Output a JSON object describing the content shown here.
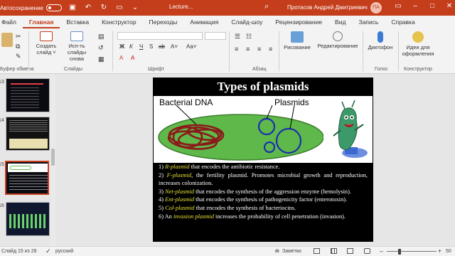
{
  "titlebar": {
    "autosave": "Автосохранение",
    "doc": "Lecture...",
    "user": "Протасов Андрей Дмитриевич",
    "avatar": "ПА"
  },
  "tabs": [
    "Файл",
    "Главная",
    "Вставка",
    "Конструктор",
    "Переходы",
    "Анимация",
    "Слайд-шоу",
    "Рецензирование",
    "Вид",
    "Запись",
    "Справка"
  ],
  "ribbon": {
    "create_slide": "Создать слайд ˅",
    "reuse": "Исп-ть слайды снова",
    "groups": {
      "clipboard": "Буфер обмена",
      "slides": "Слайды",
      "font": "Шрифт",
      "paragraph": "Абзац",
      "voice": "Голос",
      "designer": "Конструктор"
    },
    "drawing": "Рисование",
    "editing": "Редактирование",
    "dictate": "Диктофон",
    "ideas": "Идеи для оформления",
    "fmt": [
      "Ж",
      "К",
      "Ч",
      "S",
      "ab",
      "A˅",
      "Аа˅",
      "A",
      "A"
    ]
  },
  "slides": {
    "numbers": [
      "13",
      "14",
      "15",
      "16"
    ]
  },
  "slide": {
    "title": "Types of plasmids",
    "label_dna": "Bacterial DNA",
    "label_plasmids": "Plasmids",
    "items": [
      {
        "n": "1)",
        "name": "R-plasmid",
        "text": " that encodes the antibiotic resistance."
      },
      {
        "n": "2)",
        "name": "F-plasmid",
        "text": ", the fertility plasmid. Promotes microbial growth and reproduction, increases colonization."
      },
      {
        "n": "3)",
        "name": "Net-plasmid",
        "text": " that encodes the synthesis of the aggression enzyme (hemolysin)."
      },
      {
        "n": "4)",
        "name": "Ent-plasmid",
        "text": " that encodes the synthesis of pathogenicity factor (enterotoxin)."
      },
      {
        "n": "5)",
        "name": "Col-plasmid",
        "text": " that encodes the synthesis of bacteriocins."
      },
      {
        "n": "6) An",
        "name": "invasion plasmid",
        "text": " increases the probability of cell penetration (invasion)."
      }
    ]
  },
  "status": {
    "slide": "Слайд 15 из 28",
    "lang": "русский",
    "notes": "Заметки",
    "zoom": "50"
  },
  "colors": {
    "accent": "#c43e1c",
    "plasmid": "#1a2fb0",
    "dna": "#8b1a1a",
    "cell": "#5fb84a"
  }
}
